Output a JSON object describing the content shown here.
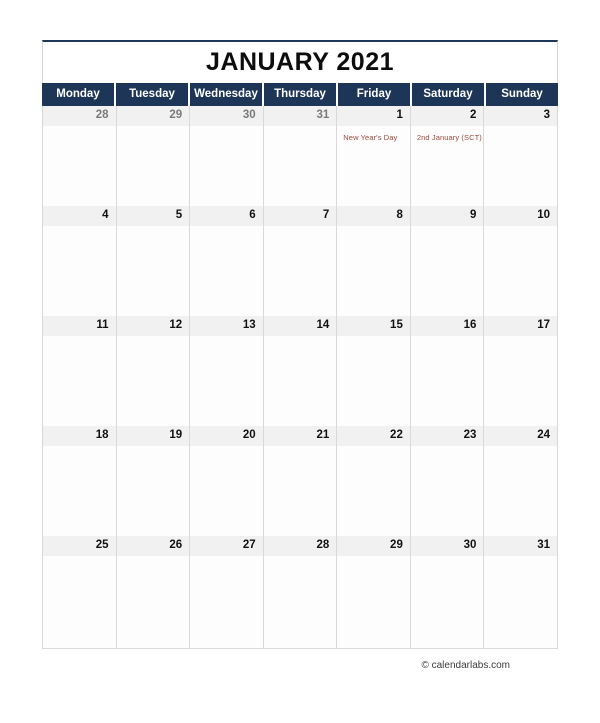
{
  "calendar": {
    "title": "JANUARY 2021",
    "month": "January",
    "year": "2021",
    "week_start": "Monday",
    "colors": {
      "header_background": "#1d3557",
      "header_text": "#ffffff",
      "day_number_band": "#f1f1f1",
      "day_number_text": "#111111",
      "other_month_text": "#7a7a7a",
      "event_text": "#9b4a3d",
      "grid_line": "#d9d9d9",
      "cell_background": "#fdfdfd",
      "title_text": "#0d0d0d"
    },
    "weekdays": [
      {
        "label": "Monday"
      },
      {
        "label": "Tuesday"
      },
      {
        "label": "Wednesday"
      },
      {
        "label": "Thursday"
      },
      {
        "label": "Friday"
      },
      {
        "label": "Saturday"
      },
      {
        "label": "Sunday"
      }
    ],
    "weeks": [
      {
        "days": [
          {
            "num": "28",
            "other_month": true,
            "events": []
          },
          {
            "num": "29",
            "other_month": true,
            "events": []
          },
          {
            "num": "30",
            "other_month": true,
            "events": []
          },
          {
            "num": "31",
            "other_month": true,
            "events": []
          },
          {
            "num": "1",
            "other_month": false,
            "events": [
              "New Year's Day"
            ]
          },
          {
            "num": "2",
            "other_month": false,
            "events": [
              "2nd January (SCT)"
            ]
          },
          {
            "num": "3",
            "other_month": false,
            "events": []
          }
        ]
      },
      {
        "days": [
          {
            "num": "4",
            "other_month": false,
            "events": []
          },
          {
            "num": "5",
            "other_month": false,
            "events": []
          },
          {
            "num": "6",
            "other_month": false,
            "events": []
          },
          {
            "num": "7",
            "other_month": false,
            "events": []
          },
          {
            "num": "8",
            "other_month": false,
            "events": []
          },
          {
            "num": "9",
            "other_month": false,
            "events": []
          },
          {
            "num": "10",
            "other_month": false,
            "events": []
          }
        ]
      },
      {
        "days": [
          {
            "num": "11",
            "other_month": false,
            "events": []
          },
          {
            "num": "12",
            "other_month": false,
            "events": []
          },
          {
            "num": "13",
            "other_month": false,
            "events": []
          },
          {
            "num": "14",
            "other_month": false,
            "events": []
          },
          {
            "num": "15",
            "other_month": false,
            "events": []
          },
          {
            "num": "16",
            "other_month": false,
            "events": []
          },
          {
            "num": "17",
            "other_month": false,
            "events": []
          }
        ]
      },
      {
        "days": [
          {
            "num": "18",
            "other_month": false,
            "events": []
          },
          {
            "num": "19",
            "other_month": false,
            "events": []
          },
          {
            "num": "20",
            "other_month": false,
            "events": []
          },
          {
            "num": "21",
            "other_month": false,
            "events": []
          },
          {
            "num": "22",
            "other_month": false,
            "events": []
          },
          {
            "num": "23",
            "other_month": false,
            "events": []
          },
          {
            "num": "24",
            "other_month": false,
            "events": []
          }
        ]
      },
      {
        "days": [
          {
            "num": "25",
            "other_month": false,
            "events": []
          },
          {
            "num": "26",
            "other_month": false,
            "events": []
          },
          {
            "num": "27",
            "other_month": false,
            "events": []
          },
          {
            "num": "28",
            "other_month": false,
            "events": []
          },
          {
            "num": "29",
            "other_month": false,
            "events": []
          },
          {
            "num": "30",
            "other_month": false,
            "events": []
          },
          {
            "num": "31",
            "other_month": false,
            "events": []
          }
        ]
      }
    ]
  },
  "footer": {
    "copyright": "© calendarlabs.com"
  }
}
